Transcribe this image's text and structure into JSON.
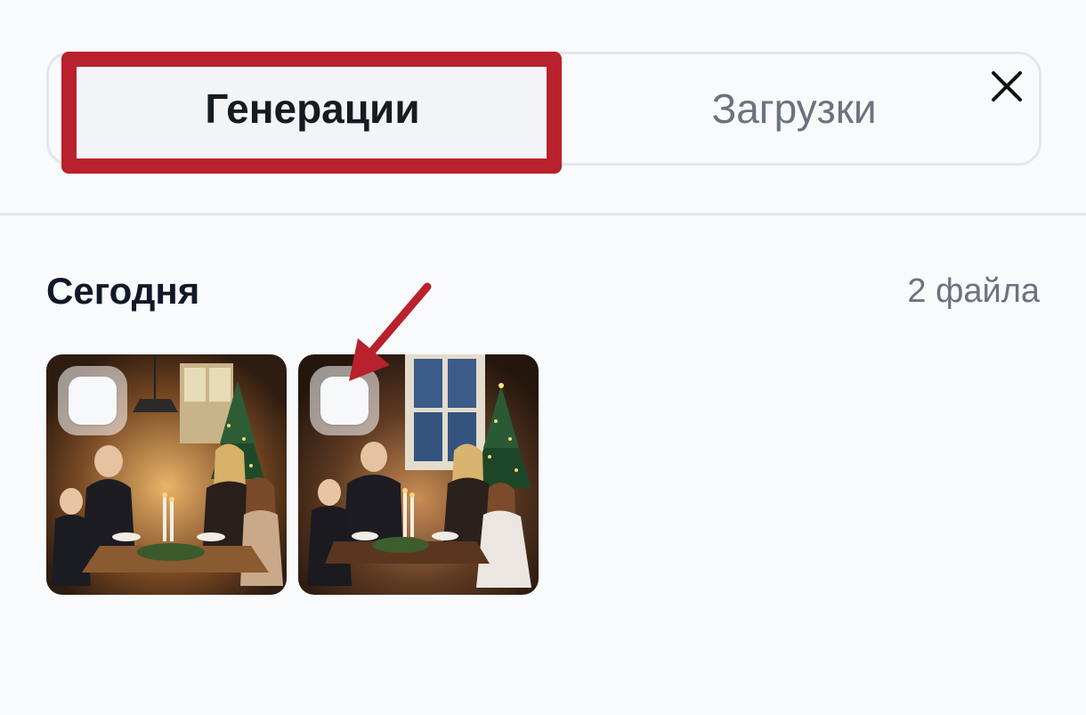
{
  "tabs": {
    "generations_label": "Генерации",
    "uploads_label": "Загрузки"
  },
  "close_icon": "close-icon",
  "section": {
    "title": "Сегодня",
    "count": "2 файла"
  },
  "thumbnails": [
    {
      "description_icon": "family-christmas-dinner-image",
      "checkbox": "unchecked"
    },
    {
      "description_icon": "family-christmas-dinner-image",
      "checkbox": "unchecked"
    }
  ],
  "colors": {
    "annotation_red": "#b9212c",
    "background": "#f8fafc",
    "muted_text": "#6b7280"
  }
}
